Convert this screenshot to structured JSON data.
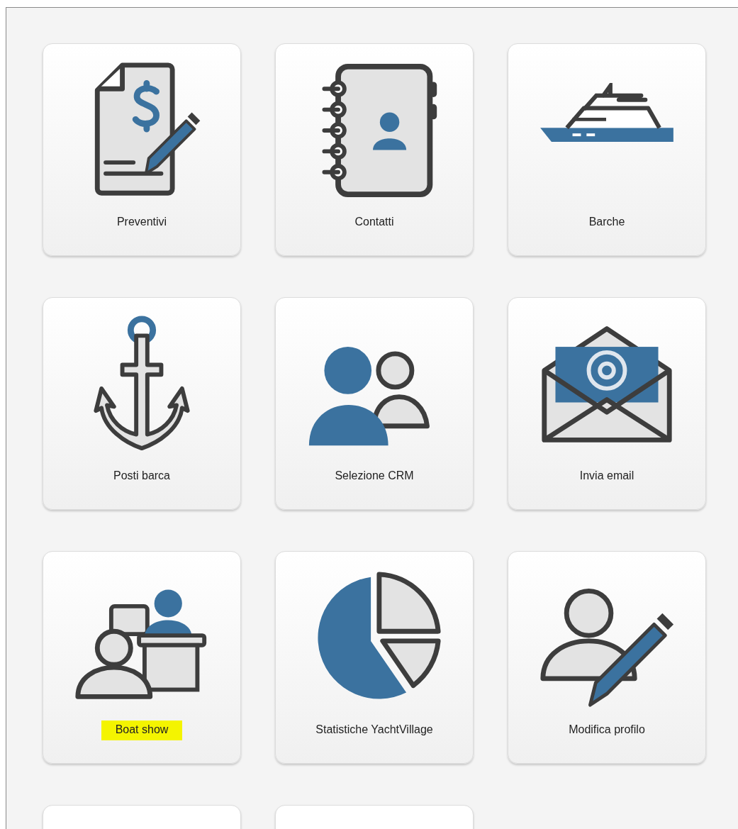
{
  "tiles": [
    {
      "kind": "app",
      "label": "Preventivi",
      "highlighted": false
    },
    {
      "kind": "app",
      "label": "Contatti",
      "highlighted": false
    },
    {
      "kind": "app",
      "label": "Barche",
      "highlighted": false
    },
    {
      "kind": "app",
      "label": "Posti barca",
      "highlighted": false
    },
    {
      "kind": "app",
      "label": "Selezione CRM",
      "highlighted": false
    },
    {
      "kind": "app",
      "label": "Invia email",
      "highlighted": false
    },
    {
      "kind": "app",
      "label": "Boat show",
      "highlighted": true
    },
    {
      "kind": "app",
      "label": "Statistiche YachtVillage",
      "highlighted": false
    },
    {
      "kind": "app",
      "label": "Modifica profilo",
      "highlighted": false
    },
    {
      "kind": "blank"
    },
    {
      "kind": "blank"
    }
  ]
}
